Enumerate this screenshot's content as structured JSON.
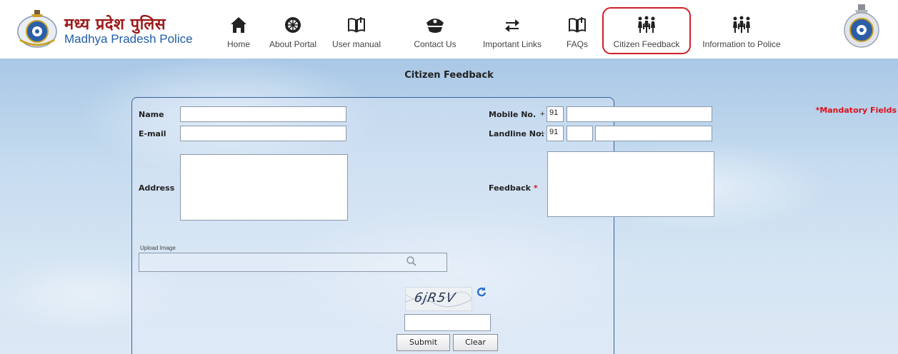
{
  "brand": {
    "hindi": "मध्य प्रदेश पुलिस",
    "english": "Madhya Pradesh Police"
  },
  "nav": [
    {
      "label": "Home",
      "icon": "home-icon"
    },
    {
      "label": "About Portal",
      "icon": "chakra-icon"
    },
    {
      "label": "User manual",
      "icon": "book-icon"
    },
    {
      "label": "Contact Us",
      "icon": "police-cap-icon"
    },
    {
      "label": "Important Links",
      "icon": "swap-arrows-icon"
    },
    {
      "label": "FAQs",
      "icon": "book-icon"
    },
    {
      "label": "Citizen Feedback",
      "icon": "people-icon"
    },
    {
      "label": "Information to Police",
      "icon": "people-icon"
    }
  ],
  "page": {
    "title": "Citizen Feedback",
    "mandatory_note": "*Mandatory Fields"
  },
  "form": {
    "name_label": "Name",
    "email_label": "E-mail",
    "address_label": "Address",
    "mobile_label": "Mobile No.",
    "mobile_plus": "+",
    "mobile_code": "91",
    "landline_label": "Landline No.",
    "landline_plus": "+",
    "landline_code": "91",
    "feedback_label": "Feedback",
    "feedback_required_mark": "*",
    "upload_label": "Upload Image"
  },
  "captcha": {
    "text": "6jR5V"
  },
  "buttons": {
    "submit": "Submit",
    "clear": "Clear"
  },
  "colors": {
    "brand_red": "#9c1a1a",
    "brand_blue": "#1f5da8",
    "highlight": "#d0202a",
    "required": "#e0101a"
  }
}
